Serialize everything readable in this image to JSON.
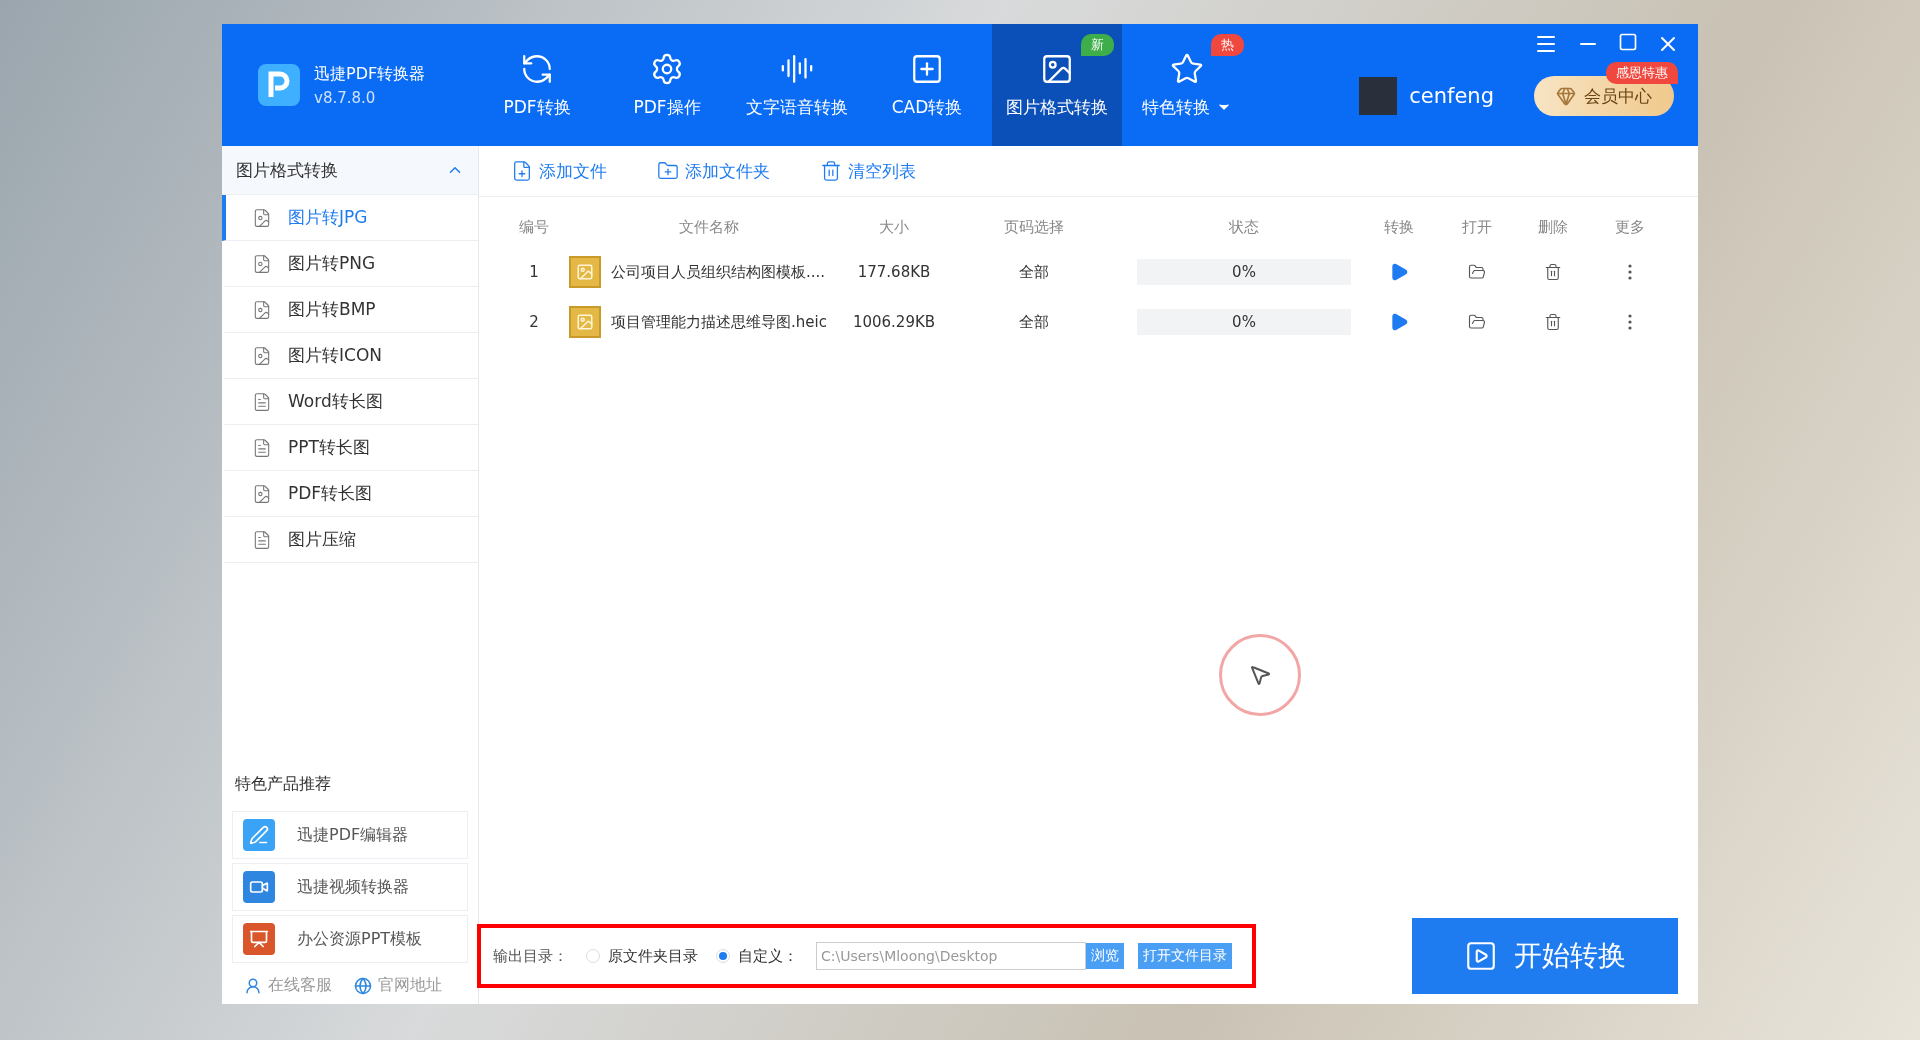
{
  "app": {
    "name": "迅捷PDF转换器",
    "version": "v8.7.8.0"
  },
  "nav": [
    {
      "kind": "pdf-convert",
      "label": "PDF转换",
      "selected": false
    },
    {
      "kind": "pdf-ops",
      "label": "PDF操作",
      "selected": false
    },
    {
      "kind": "speech",
      "label": "文字语音转换",
      "selected": false
    },
    {
      "kind": "cad",
      "label": "CAD转换",
      "selected": false
    },
    {
      "kind": "image",
      "label": "图片格式转换",
      "selected": true,
      "badge": {
        "text": "新",
        "color": "#3dae4a"
      }
    },
    {
      "kind": "special",
      "label": "特色转换",
      "selected": false,
      "dropdown": true,
      "badge": {
        "text": "热",
        "color": "#f0483e"
      }
    }
  ],
  "user": {
    "name": "cenfeng"
  },
  "vip": {
    "label": "会员中心",
    "badge": "感恩特惠"
  },
  "sidebar": {
    "title": "图片格式转换",
    "expanded": true,
    "items": [
      {
        "kind": "image",
        "label": "图片转JPG",
        "selected": true
      },
      {
        "kind": "image",
        "label": "图片转PNG",
        "selected": false
      },
      {
        "kind": "image",
        "label": "图片转BMP",
        "selected": false
      },
      {
        "kind": "image",
        "label": "图片转ICON",
        "selected": false
      },
      {
        "kind": "doc",
        "label": "Word转长图",
        "selected": false
      },
      {
        "kind": "doc",
        "label": "PPT转长图",
        "selected": false
      },
      {
        "kind": "image",
        "label": "PDF转长图",
        "selected": false
      },
      {
        "kind": "doc",
        "label": "图片压缩",
        "selected": false
      }
    ]
  },
  "promo": {
    "title": "特色产品推荐",
    "products": [
      {
        "kind": "editor",
        "label": "迅捷PDF编辑器"
      },
      {
        "kind": "video",
        "label": "迅捷视频转换器"
      },
      {
        "kind": "ppt",
        "label": "办公资源PPT模板"
      }
    ],
    "links": [
      {
        "kind": "service",
        "label": "在线客服"
      },
      {
        "kind": "web",
        "label": "官网地址"
      }
    ]
  },
  "toolbar": [
    {
      "kind": "file",
      "label": "添加文件"
    },
    {
      "kind": "folder",
      "label": "添加文件夹"
    },
    {
      "kind": "clear",
      "label": "清空列表"
    }
  ],
  "table": {
    "columns": [
      "编号",
      "文件名称",
      "大小",
      "页码选择",
      "状态",
      "转换",
      "打开",
      "删除",
      "更多"
    ],
    "rows": [
      {
        "no": "1",
        "name": "公司项目人员组织结构图模板....",
        "size": "177.68KB",
        "pages": "全部",
        "status": "0%",
        "level": 0
      },
      {
        "no": "2",
        "name": "项目管理能力描述思维导图.heic",
        "size": "1006.29KB",
        "pages": "全部",
        "status": "0%",
        "level": 0
      }
    ]
  },
  "output": {
    "label": "输出目录：",
    "options": [
      {
        "label": "原文件夹目录",
        "selected": false
      },
      {
        "label": "自定义：",
        "selected": true
      }
    ],
    "path": "C:\\Users\\Mloong\\Desktop",
    "browse": "浏览",
    "open_folder": "打开文件目录"
  },
  "start": {
    "label": "开始转换"
  }
}
